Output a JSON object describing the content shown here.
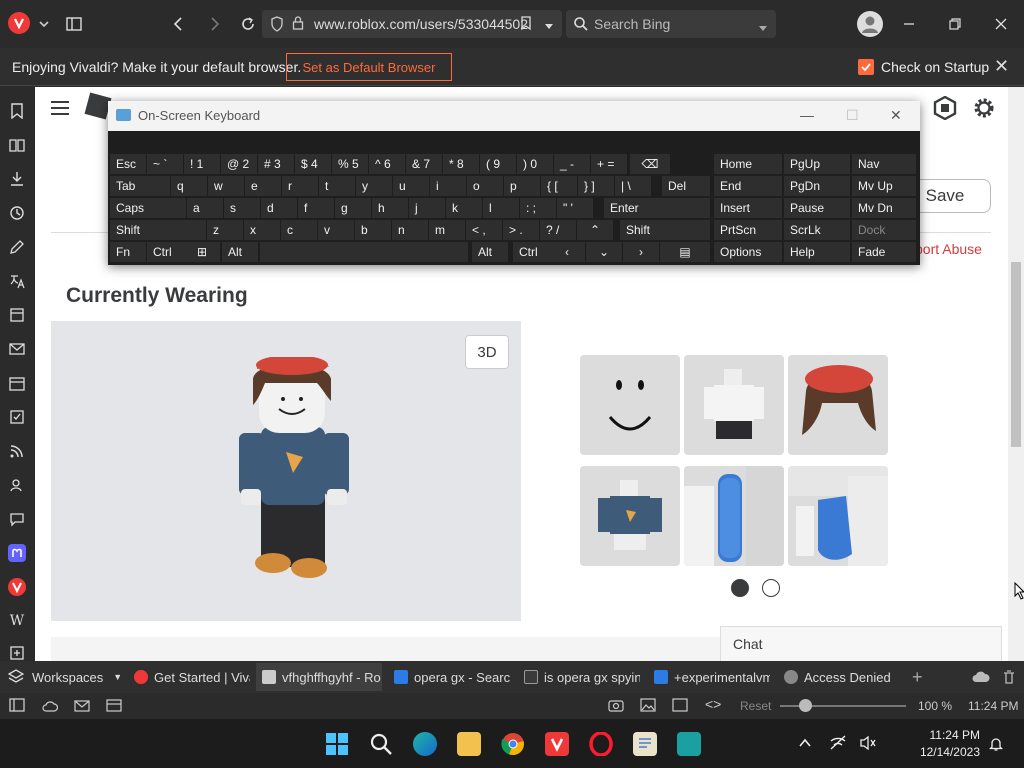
{
  "browser": {
    "url": "www.roblox.com/users/533044502",
    "search_placeholder": "Search Bing"
  },
  "notification": {
    "message": "Enjoying Vivaldi? Make it your default browser.",
    "default_button": "Set as Default Browser",
    "startup_label": "Check on Startup"
  },
  "page": {
    "save_label": "Save",
    "report_abuse": "port Abuse",
    "section_title": "Currently Wearing",
    "view_3d": "3D",
    "chat_label": "Chat"
  },
  "osk": {
    "title": "On-Screen Keyboard",
    "rows": [
      [
        "Esc",
        "~ `",
        "! 1",
        "@ 2",
        "# 3",
        "$ 4",
        "% 5",
        "^ 6",
        "& 7",
        "* 8",
        "( 9",
        ") 0",
        "_ -",
        "+ ="
      ],
      [
        "Tab",
        "q",
        "w",
        "e",
        "r",
        "t",
        "y",
        "u",
        "i",
        "o",
        "p",
        "{ [",
        "} ]",
        "| \\",
        "Del"
      ],
      [
        "Caps",
        "a",
        "s",
        "d",
        "f",
        "g",
        "h",
        "j",
        "k",
        "l",
        ": ;",
        "\" '",
        "Enter"
      ],
      [
        "Shift",
        "z",
        "x",
        "c",
        "v",
        "b",
        "n",
        "m",
        "< ,",
        "> .",
        "? /",
        "Shift"
      ],
      [
        "Fn",
        "Ctrl",
        "Alt",
        "Alt",
        "Ctrl"
      ]
    ],
    "nav_keys": [
      [
        "Home",
        "PgUp",
        "Nav"
      ],
      [
        "End",
        "PgDn",
        "Mv Up"
      ],
      [
        "Insert",
        "Pause",
        "Mv Dn"
      ],
      [
        "PrtScn",
        "ScrLk",
        "Dock"
      ],
      [
        "Options",
        "Help",
        "Fade"
      ]
    ]
  },
  "tabs": {
    "workspaces": "Workspaces",
    "items": [
      "Get Started | Vival",
      "vfhghffhgyhf - Ro",
      "opera gx - Search",
      "is opera gx spying",
      "+experimentalvm",
      "Access Denied"
    ]
  },
  "statusbar": {
    "reset": "Reset",
    "zoom": "100 %",
    "time": "11:24 PM"
  },
  "taskbar": {
    "time": "11:24 PM",
    "date": "12/14/2023"
  },
  "colors": {
    "accent_orange": "#ff6a3d",
    "vivaldi_red": "#ef3939",
    "report_red": "#d63a3a"
  }
}
